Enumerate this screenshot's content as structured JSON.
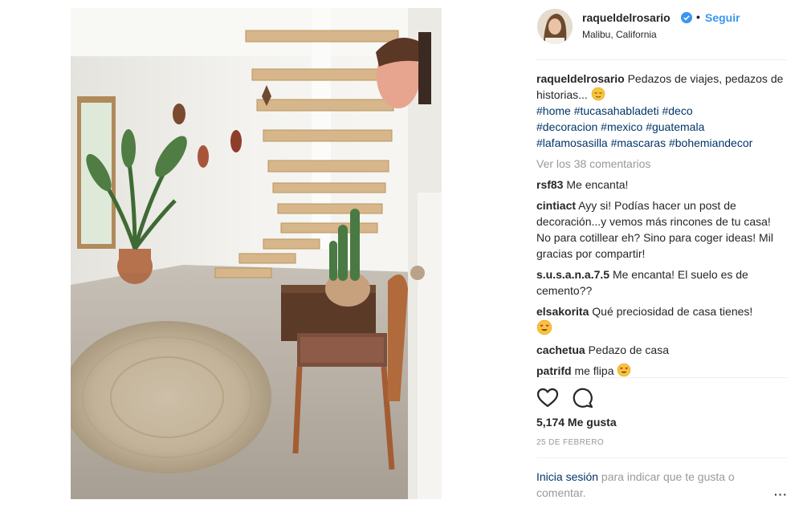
{
  "post": {
    "username": "raqueldelrosario",
    "location": "Malibu, California",
    "follow_label": "Seguir",
    "separator": "•",
    "caption_text": "Pedazos de viajes, pedazos de historias...",
    "hashtags": [
      "#home",
      "#tucasahabladeti",
      "#deco",
      "#decoracion",
      "#mexico",
      "#guatemala",
      "#lafamosasilla",
      "#mascaras",
      "#bohemiandecor"
    ],
    "view_all_comments": "Ver los 38 comentarios",
    "likes": "5,174 Me gusta",
    "date": "25 DE FEBRERO",
    "login_link": "Inicia sesión",
    "login_rest": " para indicar que te gusta o comentar.",
    "more_icon": "···"
  },
  "comments": [
    {
      "user": "rsf83",
      "text": "Me encanta!"
    },
    {
      "user": "cintiact",
      "text": "Ayy si! Podías hacer un post de decoración...y vemos más rincones de tu casa! No para cotillear eh? Sino para coger ideas! Mil gracias por compartir!"
    },
    {
      "user": "s.u.s.a.n.a.7.5",
      "text": "Me encanta! El suelo es de cemento??"
    },
    {
      "user": "elsakorita",
      "text": "Qué preciosidad de casa tienes!"
    },
    {
      "user": "cachetua",
      "text": "Pedazo de casa"
    },
    {
      "user": "patrifd",
      "text": "me flipa"
    }
  ],
  "icons": {
    "verified": "verified-badge-icon",
    "like": "heart-icon",
    "comment": "comment-bubble-icon",
    "emoji_relieved": "relieved-face-emoji",
    "emoji_heart_eyes": "heart-eyes-emoji"
  },
  "colors": {
    "link_blue": "#3897f0",
    "hashtag_blue": "#003569",
    "muted_gray": "#999999",
    "text": "#262626"
  }
}
